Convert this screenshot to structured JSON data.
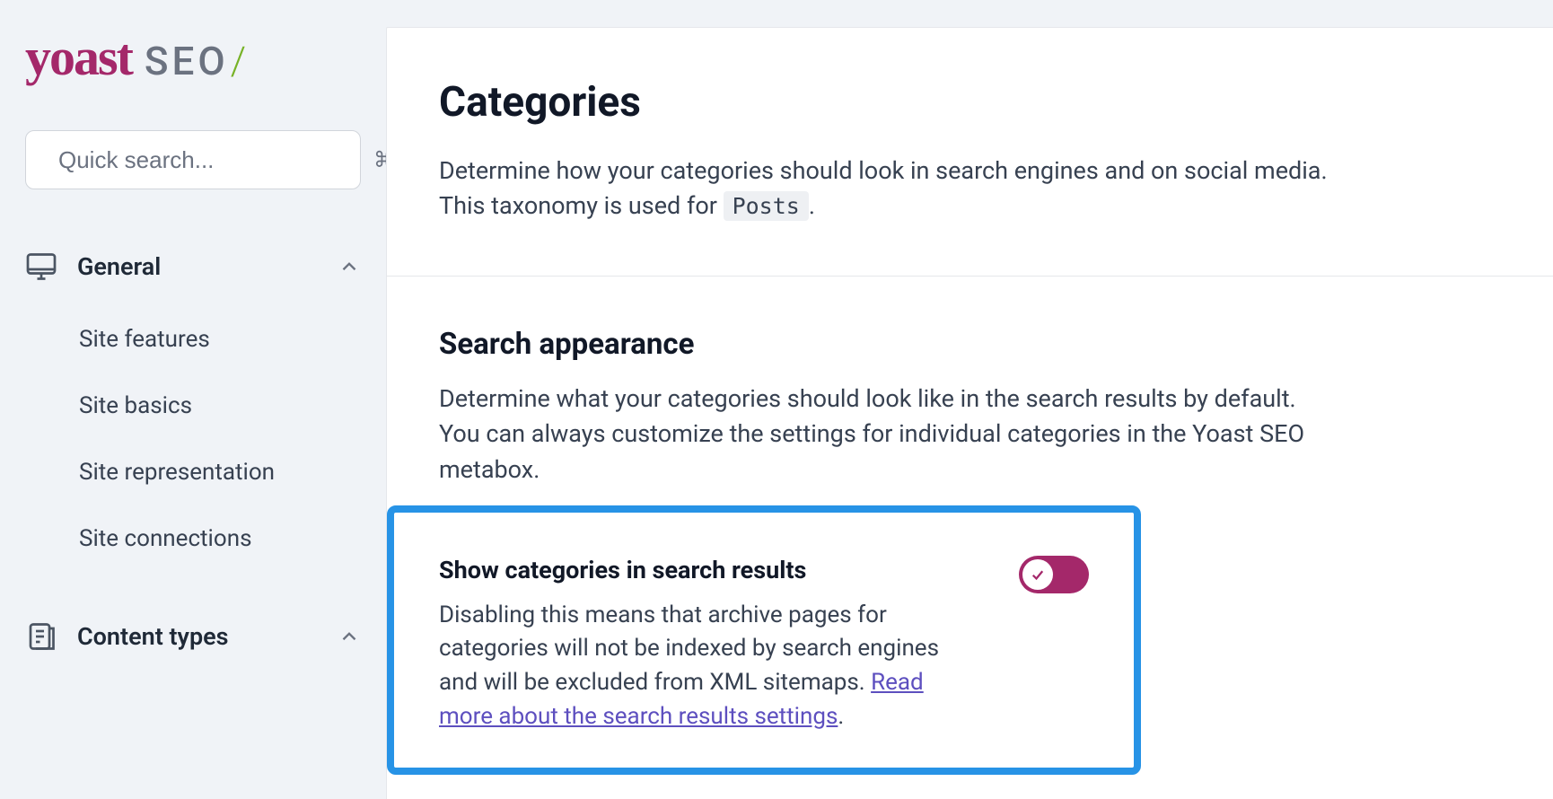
{
  "logo": {
    "brand": "yoast",
    "suffix": "SEO",
    "slash": "/"
  },
  "search": {
    "placeholder": "Quick search...",
    "shortcut": "⌘K"
  },
  "sidebar": {
    "groups": [
      {
        "label": "General",
        "expanded": true,
        "items": [
          {
            "label": "Site features"
          },
          {
            "label": "Site basics"
          },
          {
            "label": "Site representation"
          },
          {
            "label": "Site connections"
          }
        ]
      },
      {
        "label": "Content types",
        "expanded": true,
        "items": []
      }
    ]
  },
  "page": {
    "title": "Categories",
    "description_leading": "Determine how your categories should look in search engines and on social media. This taxonomy is used for ",
    "description_code": "Posts",
    "description_trailing": "."
  },
  "section": {
    "title": "Search appearance",
    "description": "Determine what your categories should look like in the search results by default. You can always customize the settings for individual categories in the Yoast SEO metabox."
  },
  "setting": {
    "label": "Show categories in search results",
    "description": "Disabling this means that archive pages for categories will not be indexed by search engines and will be excluded from XML sitemaps. ",
    "link_text": "Read more about the search results settings",
    "trailing": ".",
    "enabled": true
  }
}
